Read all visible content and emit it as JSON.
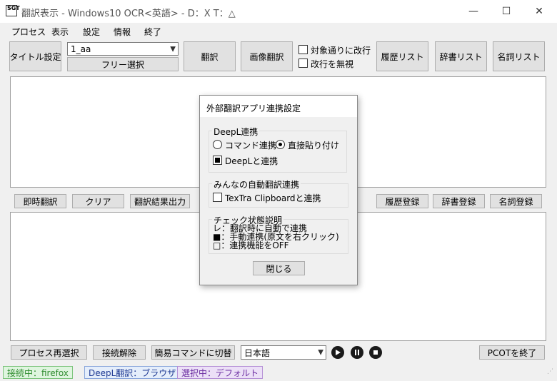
{
  "window": {
    "title": "翻訳表示 - Windows10 OCR<英語> - D：X T：△",
    "minimize_glyph": "—",
    "maximize_glyph": "☐",
    "close_glyph": "✕",
    "app_icon_text": "SGT"
  },
  "menu": [
    "プロセス",
    "表示",
    "設定",
    "情報",
    "終了"
  ],
  "toolbar": {
    "title_setting": "タイトル設定",
    "combo_value": "1_aa",
    "free_select": "フリー選択",
    "translate": "翻訳",
    "image_translate": "画像翻訳",
    "chk_newline_label": "対象通りに改行",
    "chk_ignore_label": "改行を無視",
    "history_list": "履歴リスト",
    "dictionary_list": "辞書リスト",
    "noun_list": "名詞リスト"
  },
  "midbar": {
    "instant_translate": "即時翻訳",
    "clear": "クリア",
    "output_result": "翻訳結果出力",
    "history_register": "履歴登録",
    "dictionary_register": "辞書登録",
    "noun_register": "名詞登録"
  },
  "bottombar": {
    "reselect_process": "プロセス再選択",
    "disconnect": "接続解除",
    "switch_simple": "簡易コマンドに切替",
    "language_value": "日本語",
    "exit_pcot": "PCOTを終了"
  },
  "statusbar": {
    "connected": "接続中：firefox",
    "deepl_mode": "DeepL翻訳：ブラウザ",
    "selected": "選択中：デフォルト"
  },
  "dialog": {
    "title": "外部翻訳アプリ連携設定",
    "deepl_group": "DeepL連携",
    "radio_command": "コマンド連携",
    "radio_paste": "直接貼り付け",
    "chk_deepl": "DeepLと連携",
    "minna_group": "みんなの自動翻訳連携",
    "chk_textra": "TexTra Clipboardと連携",
    "legend_group": "チェック状態説明",
    "legend_1": "レ：翻訳時に自動で連携",
    "legend_2": "■：手動連携(原文を右クリック)",
    "legend_3": "□：連携機能をOFF",
    "close": "閉じる"
  },
  "colors": {
    "status_connected_bg": "#dff5df",
    "status_connected_fg": "#2e8b2e",
    "status_deepl_bg": "#e5eefb",
    "status_deepl_fg": "#1f3a93",
    "status_selected_bg": "#ece0f7",
    "status_selected_fg": "#6a2ca0"
  }
}
